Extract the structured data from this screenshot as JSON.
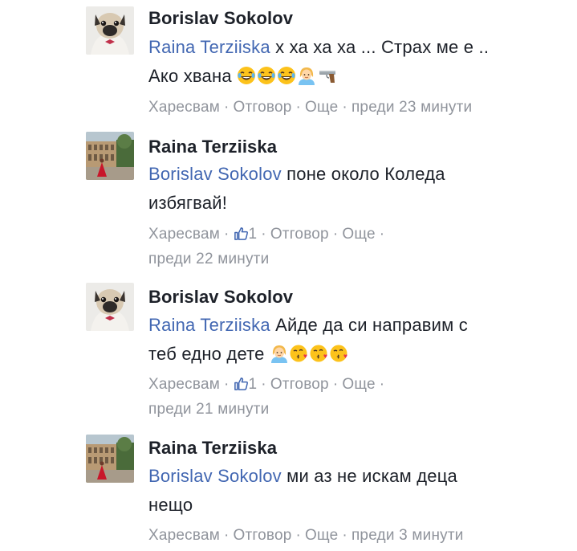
{
  "comments": [
    {
      "author": "Borislav Sokolov",
      "avatar": "pug-avatar",
      "mention": "Raina Terziiska",
      "text": " х ха ха ха ... Страх ме е ..",
      "text2": "Ако хвана",
      "emojis": [
        "laughing-crying-face-icon",
        "laughing-crying-face-icon",
        "laughing-crying-face-icon",
        "woman-icon",
        "pistol-icon"
      ],
      "actions": {
        "like": "Харесвам",
        "reply": "Отговор",
        "more": "Още",
        "time": "преди 23 минути"
      }
    },
    {
      "author": "Raina Terziiska",
      "avatar": "colosseum-avatar",
      "mention": "Borislav Sokolov",
      "text": " поне около Коледа",
      "text2": "избягвай!",
      "actions": {
        "like": "Харесвам",
        "like_count": "1",
        "reply": "Отговор",
        "more": "Още",
        "time": "преди 22 минути"
      }
    },
    {
      "author": "Borislav Sokolov",
      "avatar": "pug-avatar",
      "mention": "Raina Terziiska",
      "text": " Айде да си направим с",
      "text2": "теб едно дете",
      "emojis": [
        "woman-icon",
        "kissing-face-icon",
        "kissing-face-icon",
        "kissing-face-icon"
      ],
      "actions": {
        "like": "Харесвам",
        "like_count": "1",
        "reply": "Отговор",
        "more": "Още",
        "time": "преди 21 минути"
      }
    },
    {
      "author": "Raina Terziiska",
      "avatar": "colosseum-avatar",
      "mention": "Borislav Sokolov",
      "text": " ми аз не искам деца",
      "text2": "нещо",
      "actions": {
        "like": "Харесвам",
        "reply": "Отговор",
        "more": "Още",
        "time": "преди 3 минути"
      }
    }
  ],
  "separator": "·",
  "colors": {
    "link": "#4267b2",
    "meta": "#90949c",
    "text": "#1d2129"
  }
}
